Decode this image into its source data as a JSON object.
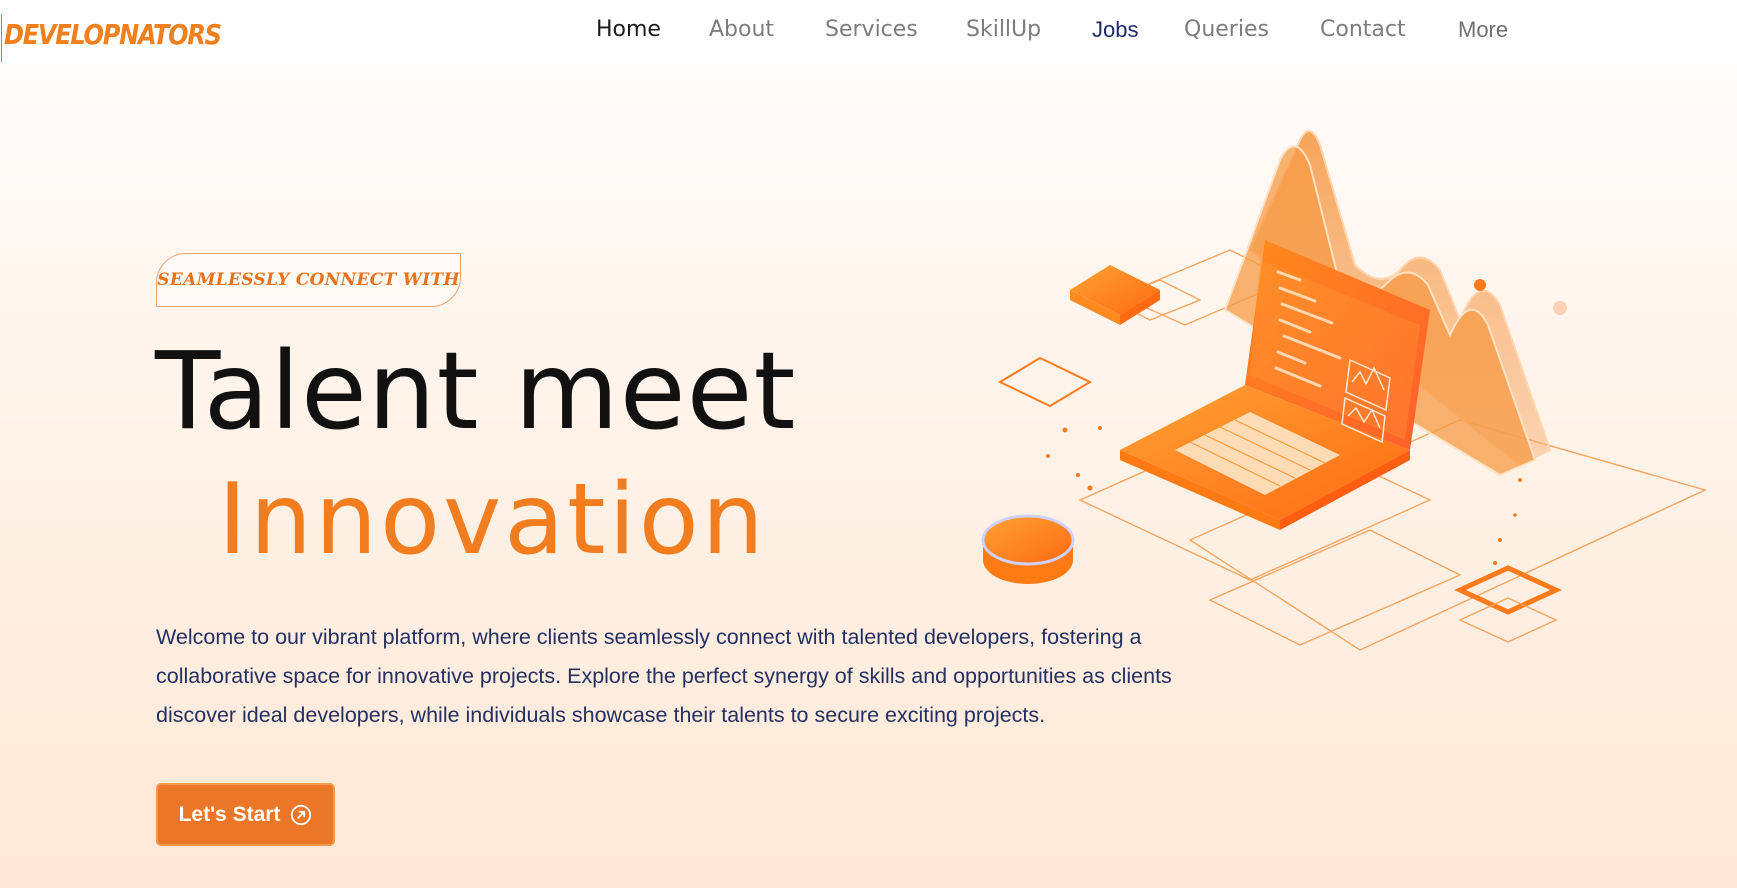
{
  "header": {
    "logo": "DEVELOPNATORS",
    "nav": [
      "Home",
      "About",
      "Services",
      "SkillUp",
      "Jobs",
      "Queries",
      "Contact",
      "More"
    ],
    "active_nav": "Home"
  },
  "hero": {
    "tagline": "SEAMLESSLY CONNECT WITH",
    "headline_line1": "Talent meet",
    "headline_line2": "Innovation",
    "description": "Welcome to our vibrant platform, where clients seamlessly connect with talented developers, fostering a collaborative space for innovative projects. Explore the perfect synergy of skills and opportunities as clients discover ideal developers, while individuals showcase their talents to secure exciting projects.",
    "cta_label": "Let's Start",
    "cta_icon": "arrow-up-right-circle-icon"
  },
  "illustration": {
    "name": "isometric-laptop-illustration",
    "icons": [
      "laptop-icon",
      "area-chart-icon",
      "coin-icon",
      "tile-icon"
    ]
  },
  "colors": {
    "accent": "#f27d1f",
    "button": "#ec7628",
    "text_dark": "#111111",
    "text_body": "#243063",
    "nav_inactive": "#7c7c7c",
    "nav_jobs": "#1f2a6b"
  }
}
